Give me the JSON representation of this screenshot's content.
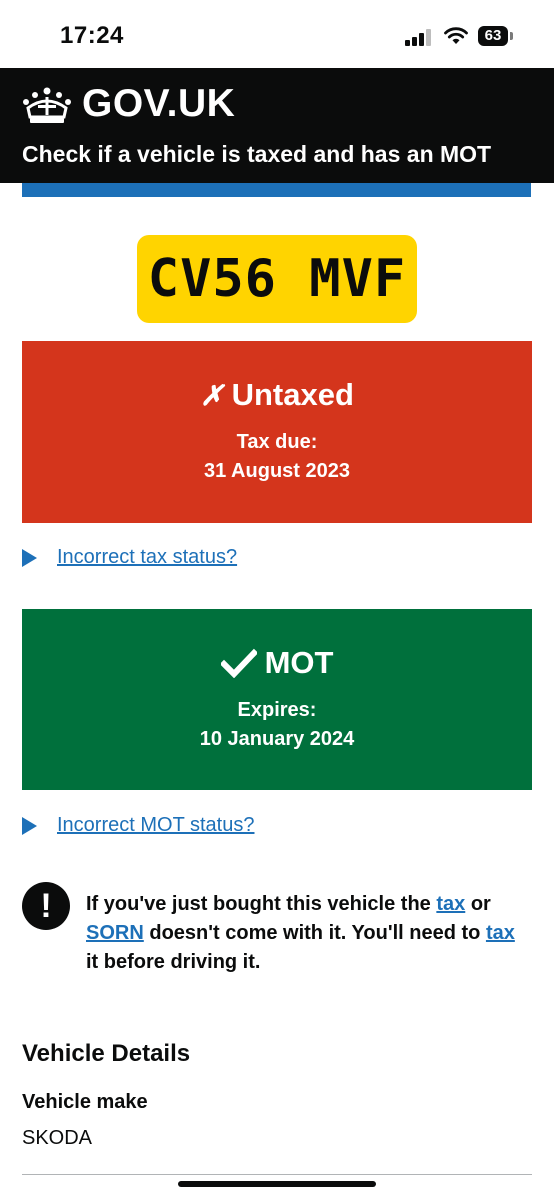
{
  "status_bar": {
    "time": "17:24",
    "battery": "63"
  },
  "header": {
    "brand": "GOV.UK",
    "service": "Check if a vehicle is taxed and has an MOT"
  },
  "registration": "CV56 MVF",
  "tax": {
    "symbol": "✗",
    "status": "Untaxed",
    "label": "Tax due:",
    "date": "31 August 2023",
    "color": "#d4351c"
  },
  "tax_link": "Incorrect tax status?",
  "mot": {
    "status": "MOT",
    "label": "Expires:",
    "date": "10 January 2024",
    "color": "#00703c"
  },
  "mot_link": "Incorrect MOT status?",
  "warning": {
    "icon": "!",
    "text_1": "If you've just bought this vehicle the ",
    "link_tax": "tax",
    "text_2": " or ",
    "link_sorn": "SORN",
    "text_3": " doesn't come with it. You'll need to ",
    "link_tax_2": "tax",
    "text_4": " it before driving it."
  },
  "vehicle_details": {
    "heading": "Vehicle Details",
    "make_label": "Vehicle make",
    "make_value": "SKODA"
  },
  "colors": {
    "header_bg": "#0b0c0c",
    "link": "#1d70b8",
    "plate": "#ffd400"
  },
  "icons": [
    "crown-icon",
    "cross-icon",
    "tick-icon",
    "disclosure-triangle-icon",
    "warning-icon",
    "signal-icon",
    "wifi-icon",
    "battery-icon"
  ]
}
